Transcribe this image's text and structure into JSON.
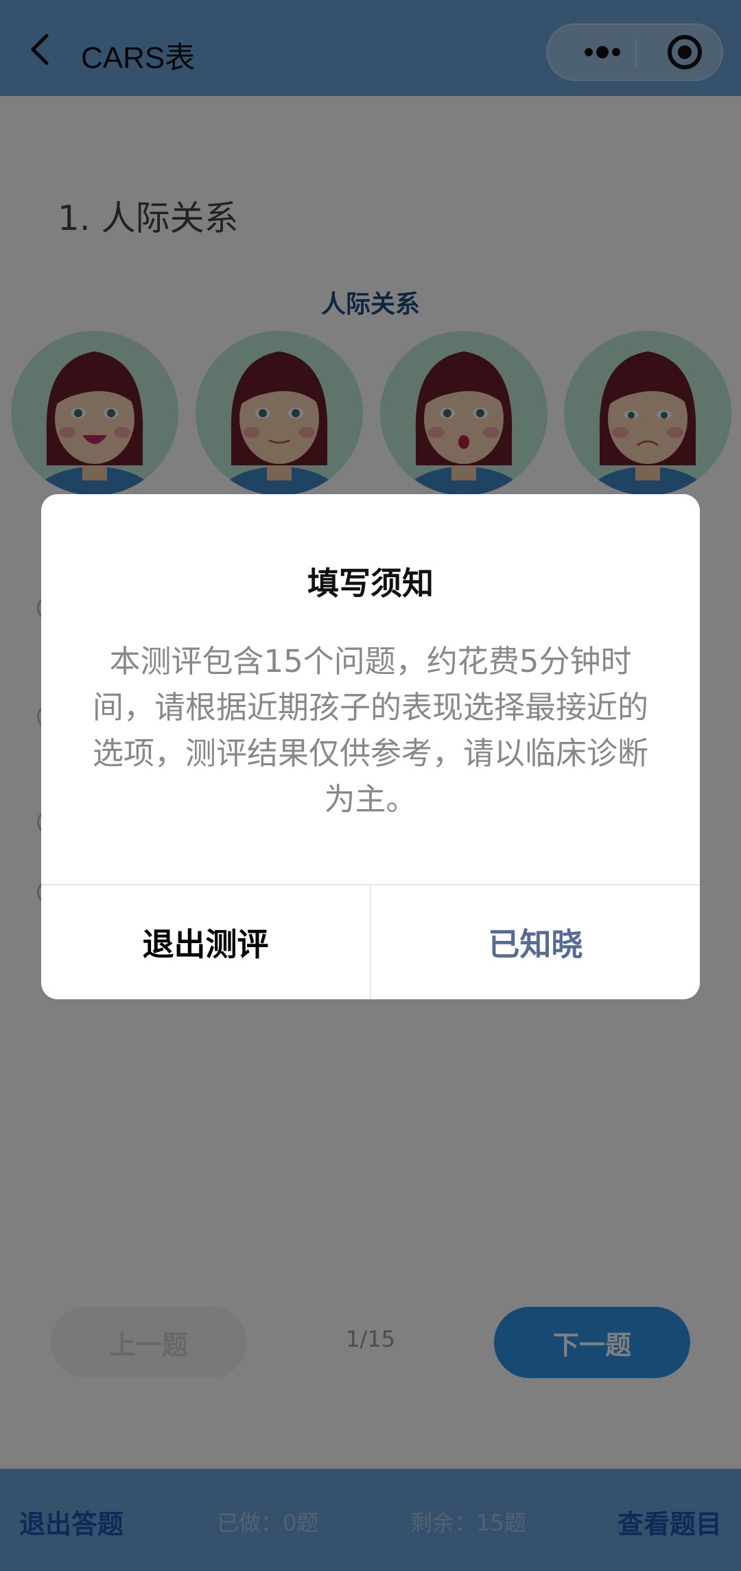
{
  "header": {
    "title": "CARS表",
    "icons": {
      "back": "chevron-left-icon",
      "more": "more-dots-icon",
      "close": "target-circle-icon"
    },
    "bg_color": "#6aa3d6"
  },
  "question": {
    "title": "1. 人际关系",
    "image_caption": "人际关系",
    "faces": [
      "happy-face-illustration",
      "neutral-face-illustration",
      "surprised-face-illustration",
      "sad-face-illustration"
    ]
  },
  "nav": {
    "prev_label": "上一题",
    "page_indicator": "1/15",
    "next_label": "下一题",
    "next_color": "#2f95e6"
  },
  "bottom_bar": {
    "exit_label": "退出答题",
    "done_text": "已做：0题",
    "remaining_text": "剩余：15题",
    "view_label": "查看题目"
  },
  "modal": {
    "title": "填写须知",
    "body": "本测评包含15个问题，约花费5分钟时间，请根据近期孩子的表现选择最接近的选项，测评结果仅供参考，请以临床诊断为主。",
    "cancel_label": "退出测评",
    "confirm_label": "已知晓",
    "confirm_color": "#576b95"
  }
}
